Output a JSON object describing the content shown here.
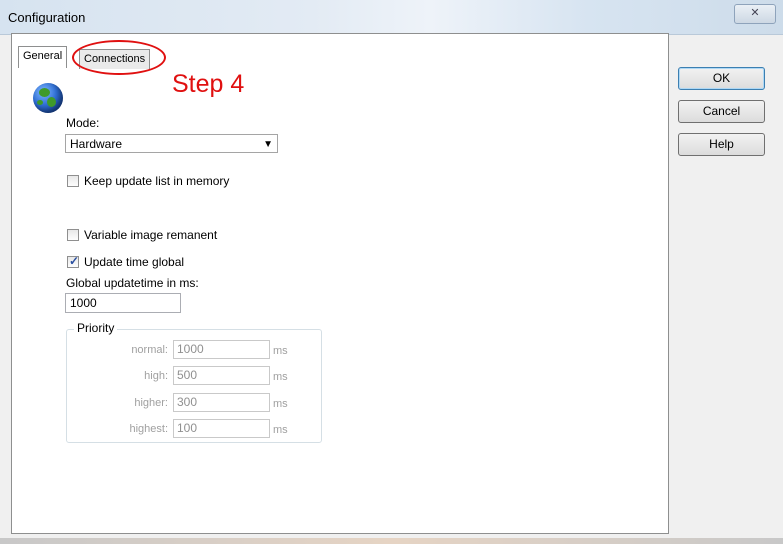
{
  "window": {
    "title": "Configuration",
    "close_label": "⌦"
  },
  "tabs": [
    {
      "label": "General"
    },
    {
      "label": "Connections"
    }
  ],
  "annotation": {
    "step_text": "Step 4",
    "color": "#e01010"
  },
  "general": {
    "mode_label": "Mode:",
    "mode_value": "Hardware",
    "keep_update_label": "Keep update list in memory",
    "keep_update_checked": false,
    "variable_image_label": "Variable image remanent",
    "variable_image_checked": false,
    "update_time_global_label": "Update time global",
    "update_time_global_checked": true,
    "global_updatetime_label": "Global updatetime in ms:",
    "global_updatetime_value": "1000"
  },
  "priority": {
    "title": "Priority",
    "rows": [
      {
        "label": "normal:",
        "value": "1000",
        "unit": "ms"
      },
      {
        "label": "high:",
        "value": "500",
        "unit": "ms"
      },
      {
        "label": "higher:",
        "value": "300",
        "unit": "ms"
      },
      {
        "label": "highest:",
        "value": "100",
        "unit": "ms"
      }
    ]
  },
  "buttons": {
    "ok": "OK",
    "cancel": "Cancel",
    "help": "Help"
  },
  "icons": {
    "globe": "globe-icon",
    "dropdown": "chevron-down-icon",
    "check": "check-icon"
  }
}
